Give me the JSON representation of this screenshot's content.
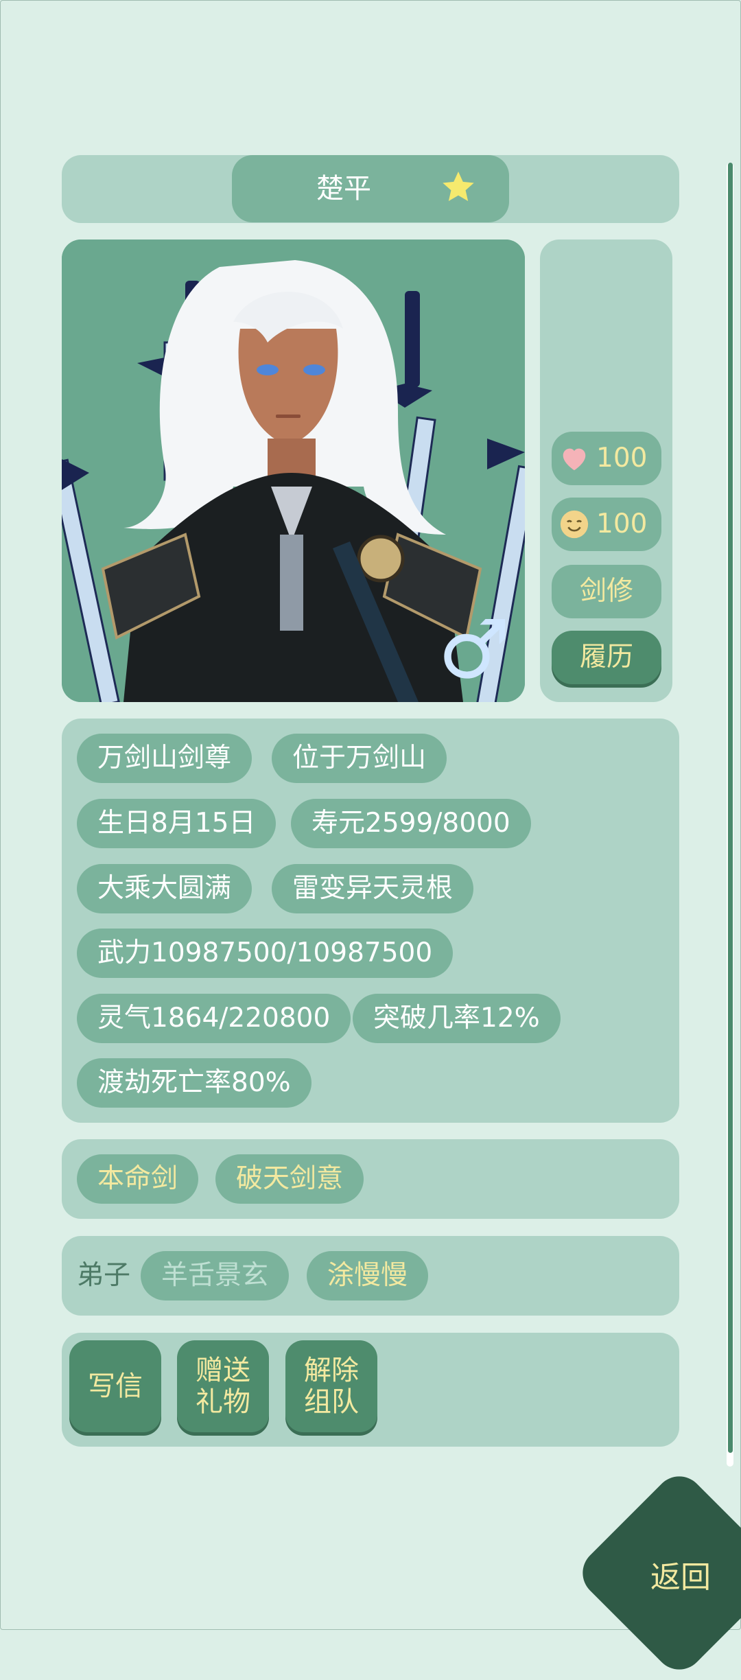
{
  "header": {
    "name": "楚平",
    "star_color": "#f6ea6e"
  },
  "portrait": {
    "gender_symbol": "♂"
  },
  "side_stats": [
    {
      "icon": "heart-icon",
      "value": "100"
    },
    {
      "icon": "smile-icon",
      "value": "100"
    },
    {
      "label": "剑修"
    },
    {
      "label": "履历"
    }
  ],
  "info_tags": [
    "万剑山剑尊",
    "位于万剑山",
    "生日8月15日",
    "寿元2599/8000",
    "大乘大圆满",
    "雷变异天灵根",
    "武力10987500/10987500",
    "灵气1864/220800",
    "突破几率12%",
    "渡劫死亡率80%"
  ],
  "skills": [
    "本命剑",
    "破天剑意"
  ],
  "disciples": {
    "label": "弟子",
    "names": [
      "羊舌景玄",
      "涂慢慢"
    ]
  },
  "actions": [
    "写信",
    "赠送礼物",
    "解除组队"
  ],
  "back_label": "返回"
}
